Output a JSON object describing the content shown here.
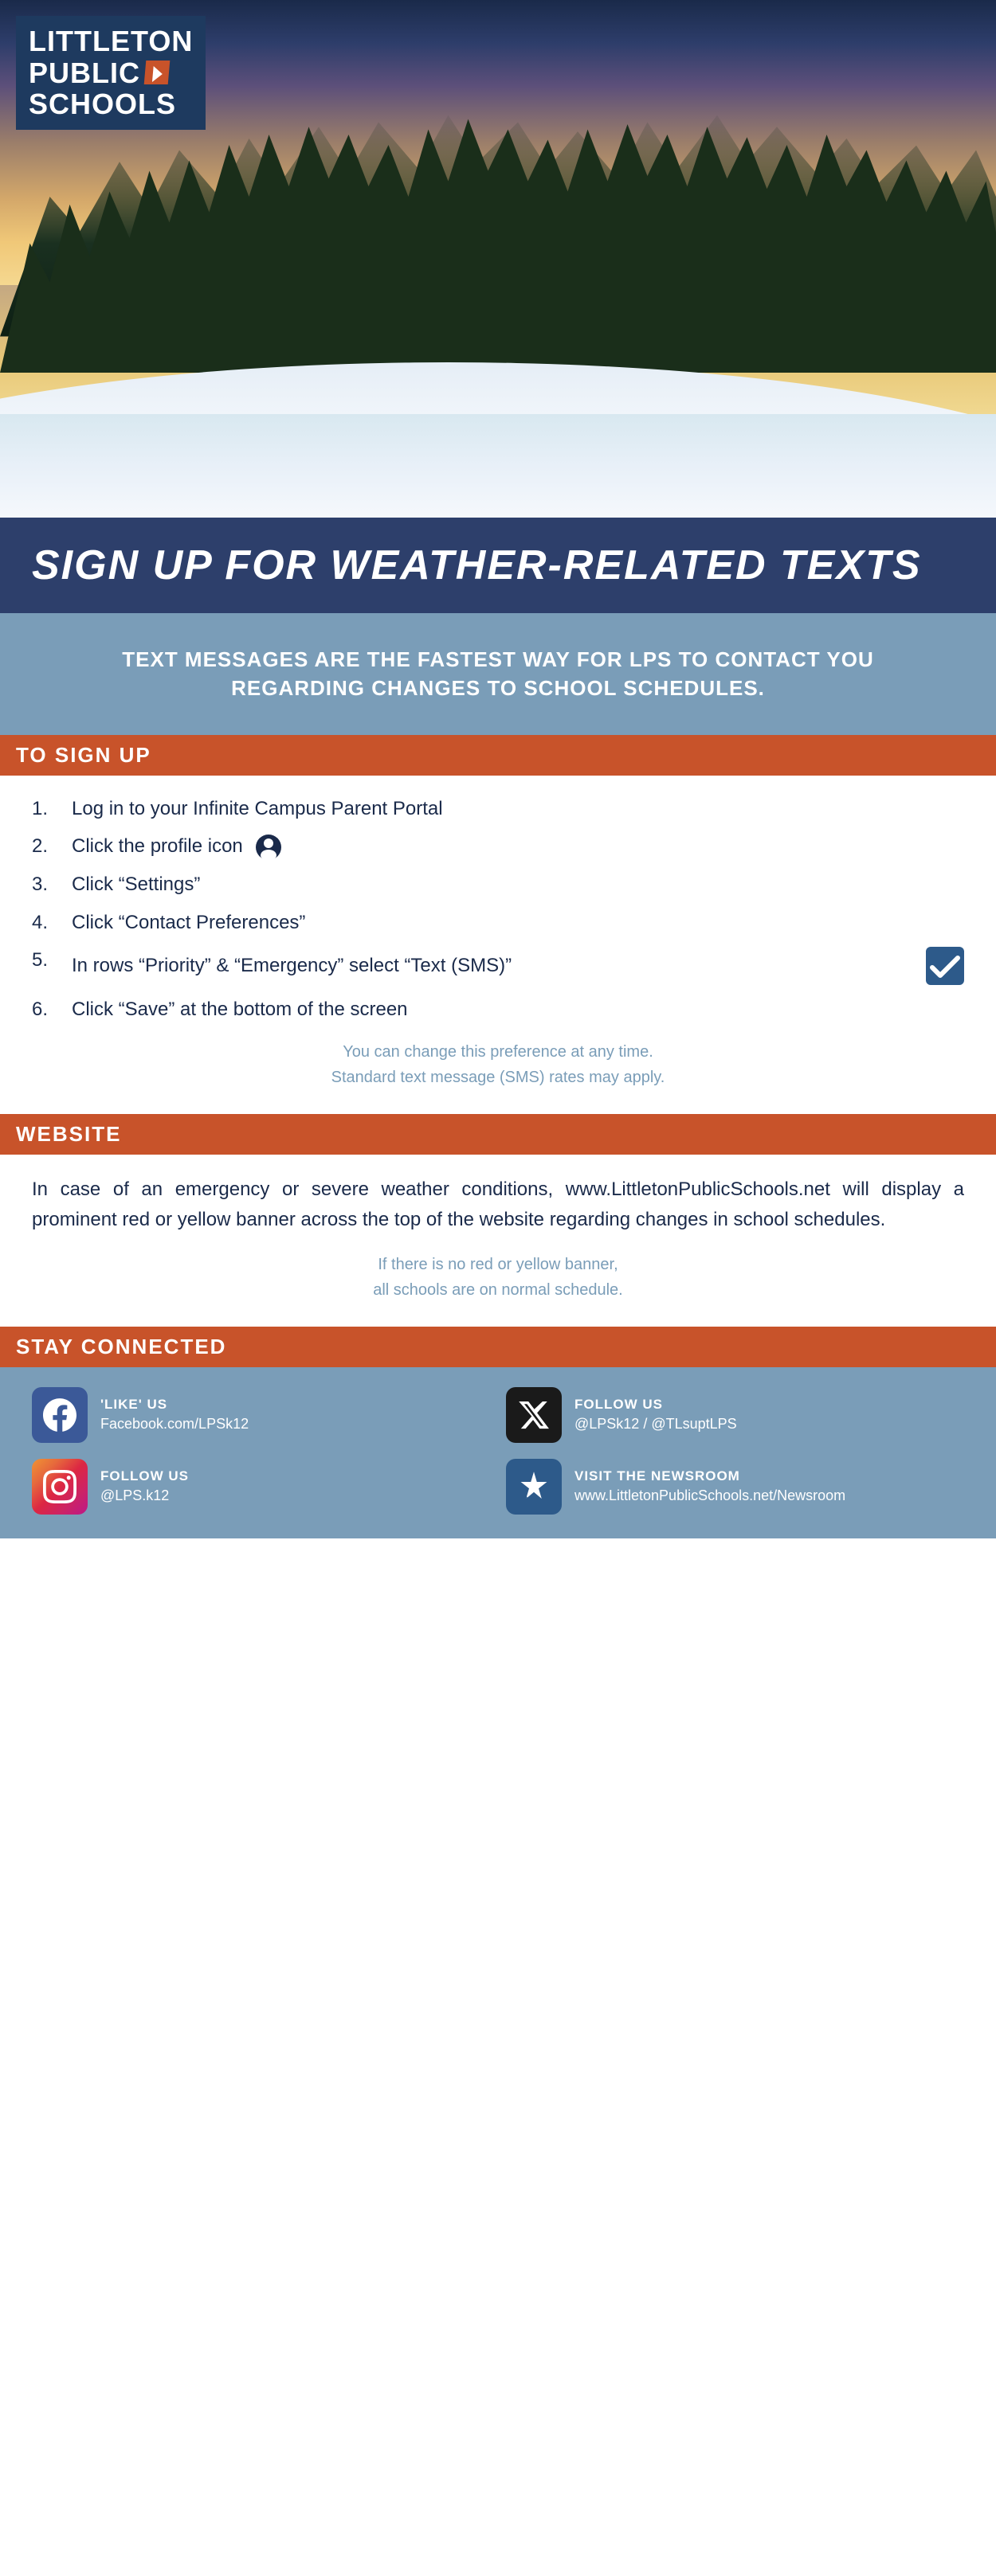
{
  "logo": {
    "line1": "LITTLETON",
    "line2": "PUBLIC",
    "line3": "SCHOOLS"
  },
  "hero_alt": "Winter forest landscape with snow-covered trees and golden sunset sky",
  "signup_heading": "SIGN UP FOR WEATHER-RELATED TEXTS",
  "info_box": {
    "text": "TEXT MESSAGES ARE THE FASTEST WAY FOR LPS TO CONTACT YOU REGARDING CHANGES TO SCHOOL SCHEDULES."
  },
  "to_sign_up": {
    "label": "TO SIGN UP",
    "steps": [
      {
        "num": "1.",
        "text": "Log in to your Infinite Campus Parent Portal"
      },
      {
        "num": "2.",
        "text": "Click the profile icon"
      },
      {
        "num": "3.",
        "text": "Click “Settings”"
      },
      {
        "num": "4.",
        "text": "Click “Contact Preferences”"
      },
      {
        "num": "5.",
        "text": "In rows “Priority” & “Emergency” select “Text (SMS)”"
      },
      {
        "num": "6.",
        "text": "Click “Save” at the bottom of the screen"
      }
    ],
    "note_line1": "You can change this preference at any time.",
    "note_line2": "Standard text message (SMS) rates may apply."
  },
  "website": {
    "label": "WEBSITE",
    "body": "In case of an emergency or severe weather conditions, www.LittletonPublicSchools.net  will  display  a  prominent red or yellow banner across the top of the website regarding changes in school schedules.",
    "note_line1": "If there is no red or yellow banner,",
    "note_line2": "all schools are on normal schedule."
  },
  "stay_connected": {
    "label": "STAY CONNECTED",
    "items": [
      {
        "platform": "facebook",
        "label": "'LIKE' US",
        "value": "Facebook.com/LPSk12",
        "icon_name": "facebook-icon"
      },
      {
        "platform": "twitter",
        "label": "FOLLOW US",
        "value": "@LPSk12 / @TLsuptLPS",
        "icon_name": "twitter-x-icon"
      },
      {
        "platform": "instagram",
        "label": "FOLLOW US",
        "value": "@LPS.k12",
        "icon_name": "instagram-icon"
      },
      {
        "platform": "newsroom",
        "label": "VISIT THE NEWSROOM",
        "value": "www.LittletonPublicSchools.net/Newsroom",
        "icon_name": "newsroom-icon"
      }
    ]
  }
}
